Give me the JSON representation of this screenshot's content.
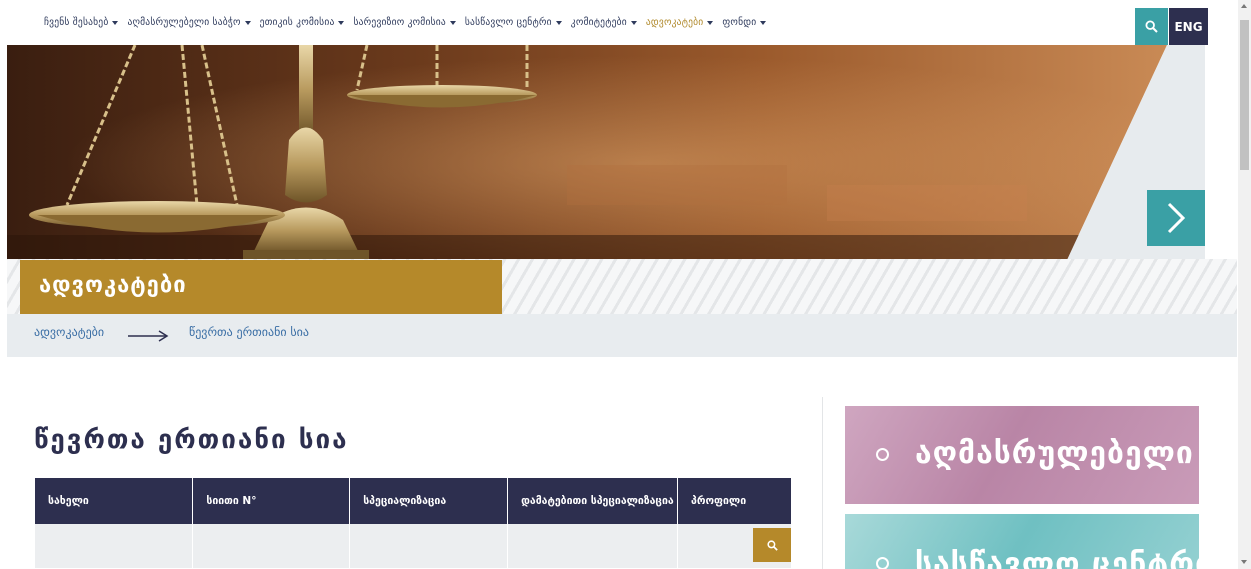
{
  "nav": {
    "items": [
      {
        "label": "ჩვენს შესახებ",
        "active": false
      },
      {
        "label": "აღმასრულებელი საბჭო",
        "active": false
      },
      {
        "label": "ეთიკის კომისია",
        "active": false
      },
      {
        "label": "სარევიზიო კომისია",
        "active": false
      },
      {
        "label": "სასწავლო ცენტრი",
        "active": false
      },
      {
        "label": "კომიტეტები",
        "active": false
      },
      {
        "label": "ადვოკატები",
        "active": true
      },
      {
        "label": "ფონდი",
        "active": false
      }
    ],
    "search_icon": "search-icon",
    "lang_label": "ENG"
  },
  "hero": {
    "next_icon": "chevron-right-icon"
  },
  "section": {
    "title": "ადვოკატები"
  },
  "breadcrumb": {
    "parent": "ადვოკატები",
    "current": "წევრთა ერთიანი სია"
  },
  "main": {
    "title": "წევრთა ერთიანი სია"
  },
  "table": {
    "headers": [
      "სახელი",
      "სიითი N°",
      "სპეციალიზაცია",
      "დამატებითი სპეციალიზაცია",
      "პროფილი"
    ],
    "search_icon": "search-icon"
  },
  "sidebar": {
    "cards": [
      {
        "label": "აღმასრულებელი საბჭო"
      },
      {
        "label": "სასწავლო ცენტრი"
      }
    ]
  },
  "colors": {
    "navy": "#2d2f4f",
    "teal": "#3aa0a5",
    "gold": "#b5892a",
    "link": "#3a6ea5"
  }
}
